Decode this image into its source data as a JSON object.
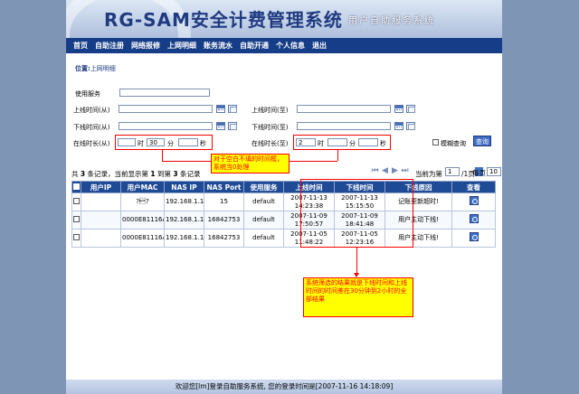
{
  "app": {
    "logo_text": "RG-SAM安全计费管理系统",
    "subtitle": "用户自助服务系统"
  },
  "nav": [
    "首页",
    "自助注册",
    "网络报修",
    "上网明细",
    "账务流水",
    "自助开通",
    "个人信息",
    "退出"
  ],
  "location": {
    "label": "位置:",
    "value": "上网明细"
  },
  "form": {
    "service_label": "使用服务",
    "online_from_label": "上线时间(从)",
    "online_to_label": "上线时间(至)",
    "offline_from_label": "下线时间(从)",
    "offline_to_label": "下线时间(至)",
    "duration_from_label": "在线时长(从)",
    "duration_to_label": "在线时长(至)",
    "hour_unit": "时",
    "minute_unit": "分",
    "second_unit": "秒",
    "duration_from": {
      "hours": "",
      "minutes": "30",
      "seconds": ""
    },
    "duration_to": {
      "hours": "2",
      "minutes": "",
      "seconds": ""
    },
    "fuzzy_label": "模糊查询",
    "query_button": "查询"
  },
  "annotations": {
    "note1": "对于空白不填的时间框，系统当0处理",
    "note2": "系统筛选的结果就是下线时间和上线时间的时间差在30分钟到2小时的全部结果"
  },
  "summary": {
    "text_prefix": "共",
    "total": "3",
    "text_mid1": "条记录，当前显示第",
    "from": "1",
    "text_mid2": "到第",
    "to": "3",
    "text_suffix": "条记录"
  },
  "pager": {
    "current_label": "当前为第",
    "current_page": "1",
    "total_pages_text": "/1页",
    "per_page_label": "每页",
    "per_page": "10"
  },
  "table": {
    "headers": [
      "用户IP",
      "用户MAC",
      "NAS IP",
      "NAS Port",
      "使用服务",
      "上线时间",
      "下线时间",
      "下线原因",
      "查看"
    ],
    "rows": [
      {
        "user_ip": "",
        "mac": "?\u0004?",
        "nas_ip": "192.168.1.1",
        "nas_port": "15",
        "service": "default",
        "online": "2007-11-13 14:23:38",
        "offline": "2007-11-13 15:15:50",
        "reason": "记账更新超时!"
      },
      {
        "user_ip": "",
        "mac": "0000E81116AB",
        "nas_ip": "192.168.1.1",
        "nas_port": "16842753",
        "service": "default",
        "online": "2007-11-09 17:50:57",
        "offline": "2007-11-09 18:41:48",
        "reason": "用户主动下线!"
      },
      {
        "user_ip": "",
        "mac": "0000E81116AB",
        "nas_ip": "192.168.1.1",
        "nas_port": "16842753",
        "service": "default",
        "online": "2007-11-05 11:48:22",
        "offline": "2007-11-05 12:23:16",
        "reason": "用户主动下线!"
      }
    ]
  },
  "footer": "欢迎您[lm]登录自助服务系统, 您的登录时间是[2007-11-16 14:18:09]"
}
